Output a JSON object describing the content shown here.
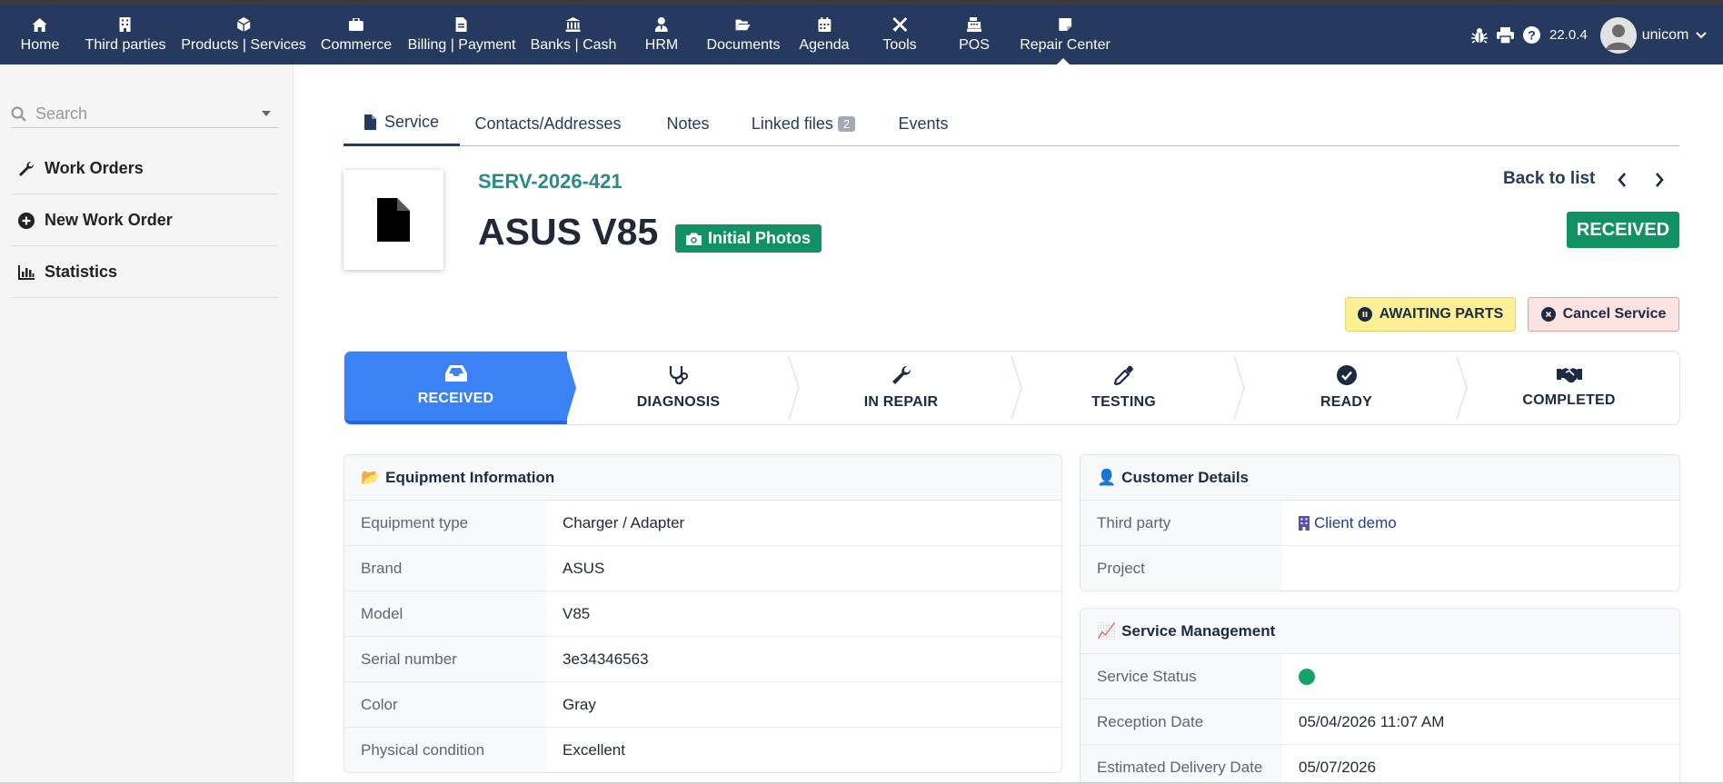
{
  "nav": {
    "items": [
      {
        "label": "Home",
        "icon": "home-icon"
      },
      {
        "label": "Third parties",
        "icon": "building-icon"
      },
      {
        "label": "Products | Services",
        "icon": "cube-icon"
      },
      {
        "label": "Commerce",
        "icon": "briefcase-icon"
      },
      {
        "label": "Billing | Payment",
        "icon": "file-invoice-icon"
      },
      {
        "label": "Banks | Cash",
        "icon": "bank-icon"
      },
      {
        "label": "HRM",
        "icon": "user-tie-icon"
      },
      {
        "label": "Documents",
        "icon": "folder-open-icon"
      },
      {
        "label": "Agenda",
        "icon": "calendar-icon"
      },
      {
        "label": "Tools",
        "icon": "tools-icon"
      },
      {
        "label": "POS",
        "icon": "cash-register-icon"
      },
      {
        "label": "Repair Center",
        "icon": "sticky-note-icon"
      }
    ],
    "version": "22.0.4",
    "user": "unicom"
  },
  "sidebar": {
    "search_placeholder": "Search",
    "items": [
      {
        "label": "Work Orders",
        "icon": "wrench-icon"
      },
      {
        "label": "New Work Order",
        "icon": "plus-circle-icon"
      },
      {
        "label": "Statistics",
        "icon": "bar-chart-icon"
      }
    ]
  },
  "tabs": [
    {
      "label": "Service",
      "active": true
    },
    {
      "label": "Contacts/Addresses"
    },
    {
      "label": "Notes"
    },
    {
      "label": "Linked files",
      "count": "2"
    },
    {
      "label": "Events"
    }
  ],
  "header": {
    "ref": "SERV-2026-421",
    "title": "ASUS V85",
    "photo_badge": "Initial Photos",
    "back_to_list": "Back to list",
    "status": "RECEIVED"
  },
  "actions": {
    "awaiting_parts": "AWAITING PARTS",
    "cancel_service": "Cancel Service"
  },
  "steps": [
    {
      "label": "RECEIVED",
      "icon": "inbox-icon",
      "active": true
    },
    {
      "label": "DIAGNOSIS",
      "icon": "stethoscope-icon"
    },
    {
      "label": "IN REPAIR",
      "icon": "wrench-icon"
    },
    {
      "label": "TESTING",
      "icon": "eye-dropper-icon"
    },
    {
      "label": "READY",
      "icon": "check-circle-icon"
    },
    {
      "label": "COMPLETED",
      "icon": "handshake-icon"
    }
  ],
  "equipment": {
    "title": "Equipment Information",
    "emoji": "📂",
    "rows": [
      {
        "label": "Equipment type",
        "value": "Charger / Adapter"
      },
      {
        "label": "Brand",
        "value": "ASUS"
      },
      {
        "label": "Model",
        "value": "V85"
      },
      {
        "label": "Serial number",
        "value": "3e34346563"
      },
      {
        "label": "Color",
        "value": "Gray"
      },
      {
        "label": "Physical condition",
        "value": "Excellent"
      }
    ]
  },
  "customer": {
    "title": "Customer Details",
    "emoji": "👤",
    "rows": [
      {
        "label": "Third party",
        "value": "Client demo"
      },
      {
        "label": "Project",
        "value": ""
      }
    ]
  },
  "service_mgmt": {
    "title": "Service Management",
    "emoji": "📈",
    "status_color": "#16a36a",
    "rows": [
      {
        "label": "Service Status",
        "value": ""
      },
      {
        "label": "Reception Date",
        "value": "05/04/2026 11:07 AM"
      },
      {
        "label": "Estimated Delivery Date",
        "value": "05/07/2026"
      }
    ]
  }
}
